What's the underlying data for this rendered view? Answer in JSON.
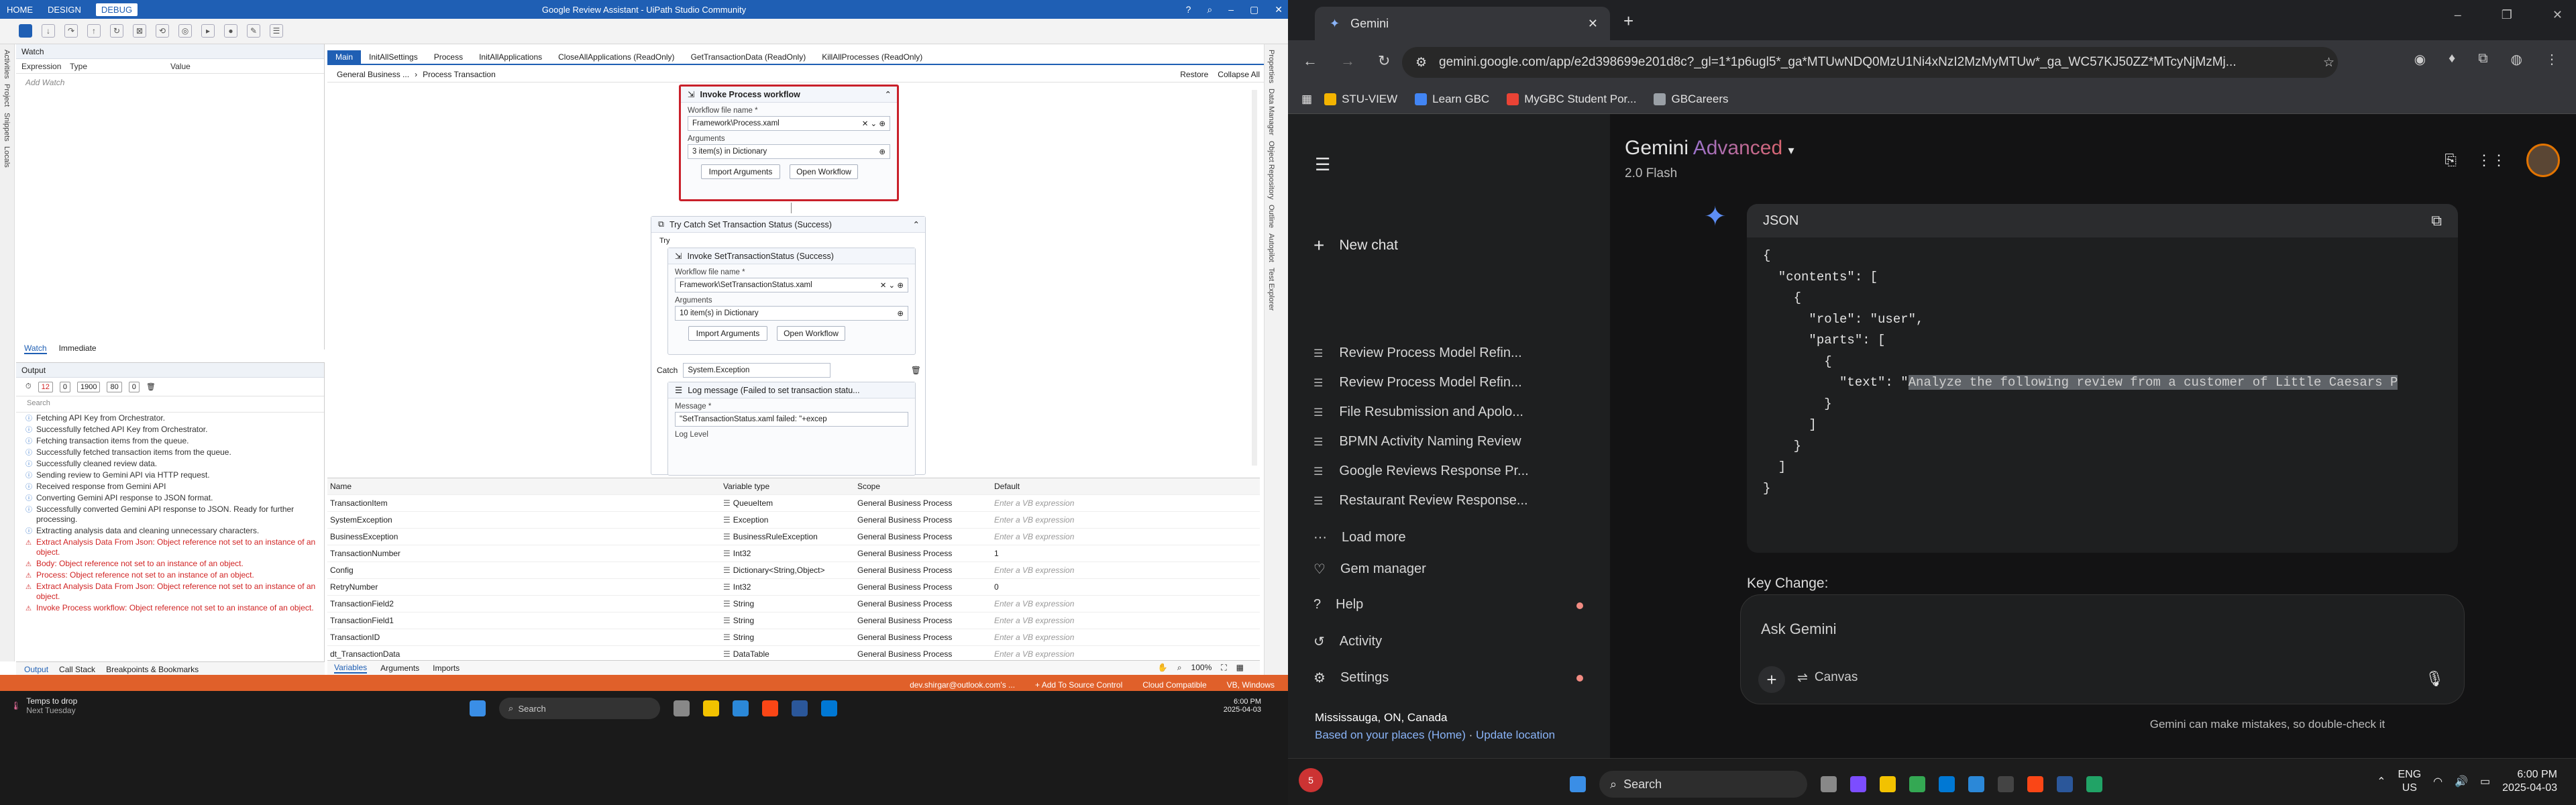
{
  "uipath": {
    "menu": [
      "HOME",
      "DESIGN",
      "DEBUG"
    ],
    "title": "Google Review Assistant - UiPath Studio Community",
    "watch": {
      "title": "Watch",
      "cols": [
        "Expression",
        "Type",
        "Value"
      ],
      "add": "Add Watch"
    },
    "side_left": [
      "Activities",
      "Project",
      "Snippets",
      "Locals"
    ],
    "wi_tabs": [
      "Watch",
      "Immediate"
    ],
    "output": {
      "title": "Output",
      "chips": [
        "12",
        "0",
        "1900",
        "80",
        "0"
      ],
      "search": "Search",
      "lines": [
        {
          "t": "Fetching API Key from Orchestrator.",
          "err": false
        },
        {
          "t": "Successfully fetched API Key from Orchestrator.",
          "err": false
        },
        {
          "t": "Fetching transaction items from the queue.",
          "err": false
        },
        {
          "t": "Successfully fetched transaction items from the queue.",
          "err": false
        },
        {
          "t": "Successfully cleaned review data.",
          "err": false
        },
        {
          "t": "Sending review to Gemini API via HTTP request.",
          "err": false
        },
        {
          "t": "Received response from Gemini API",
          "err": false
        },
        {
          "t": "Converting Gemini API response to JSON format.",
          "err": false
        },
        {
          "t": "Successfully converted Gemini API response to JSON. Ready for further processing.",
          "err": false
        },
        {
          "t": "Extracting analysis data and cleaning unnecessary characters.",
          "err": false
        },
        {
          "t": "Extract Analysis Data From Json: Object reference not set to an instance of an object.",
          "err": true
        },
        {
          "t": "Body: Object reference not set to an instance of an object.",
          "err": true
        },
        {
          "t": "Process: Object reference not set to an instance of an object.",
          "err": true
        },
        {
          "t": "Extract Analysis Data From Json: Object reference not set to an instance of an object.",
          "err": true
        },
        {
          "t": "Invoke Process workflow: Object reference not set to an instance of an object.",
          "err": true
        }
      ]
    },
    "bottom_tabs": [
      "Output",
      "Call Stack",
      "Breakpoints & Bookmarks"
    ],
    "doc_tabs": [
      "Main",
      "InitAllSettings",
      "Process",
      "InitAllApplications",
      "CloseAllApplications (ReadOnly)",
      "GetTransactionData (ReadOnly)",
      "KillAllProcesses (ReadOnly)"
    ],
    "crumbs": [
      "General Business ...",
      "Process Transaction"
    ],
    "crumb_actions": [
      "Restore",
      "Collapse All"
    ],
    "invoke_process": {
      "title": "Invoke Process workflow",
      "file_label": "Workflow file name *",
      "file": "Framework\\Process.xaml",
      "args_label": "Arguments",
      "args": "3 item(s) in Dictionary",
      "import": "Import Arguments",
      "open": "Open Workflow"
    },
    "try_catch": {
      "title": "Try Catch Set Transaction Status (Success)",
      "try": "Try",
      "catch": "Catch",
      "exception": "System.Exception"
    },
    "invoke_status": {
      "title": "Invoke SetTransactionStatus (Success)",
      "file_label": "Workflow file name *",
      "file": "Framework\\SetTransactionStatus.xaml",
      "args_label": "Arguments",
      "args": "10 item(s) in Dictionary",
      "import": "Import Arguments",
      "open": "Open Workflow"
    },
    "log_message": {
      "title": "Log message (Failed to set transaction statu...",
      "msg_label": "Message *",
      "msg": "\"SetTransactionStatus.xaml failed: \"+excep",
      "level_label": "Log Level"
    },
    "vars": {
      "headers": [
        "Name",
        "Variable type",
        "Scope",
        "Default"
      ],
      "rows": [
        {
          "name": "TransactionItem",
          "type": "QueueItem",
          "scope": "General Business Process",
          "def": "Enter a VB expression",
          "ph": true
        },
        {
          "name": "SystemException",
          "type": "Exception",
          "scope": "General Business Process",
          "def": "Enter a VB expression",
          "ph": true
        },
        {
          "name": "BusinessException",
          "type": "BusinessRuleException",
          "scope": "General Business Process",
          "def": "Enter a VB expression",
          "ph": true
        },
        {
          "name": "TransactionNumber",
          "type": "Int32",
          "scope": "General Business Process",
          "def": "1",
          "ph": false
        },
        {
          "name": "Config",
          "type": "Dictionary<String,Object>",
          "scope": "General Business Process",
          "def": "Enter a VB expression",
          "ph": true
        },
        {
          "name": "RetryNumber",
          "type": "Int32",
          "scope": "General Business Process",
          "def": "0",
          "ph": false
        },
        {
          "name": "TransactionField2",
          "type": "String",
          "scope": "General Business Process",
          "def": "Enter a VB expression",
          "ph": true
        },
        {
          "name": "TransactionField1",
          "type": "String",
          "scope": "General Business Process",
          "def": "Enter a VB expression",
          "ph": true
        },
        {
          "name": "TransactionID",
          "type": "String",
          "scope": "General Business Process",
          "def": "Enter a VB expression",
          "ph": true
        },
        {
          "name": "dt_TransactionData",
          "type": "DataTable",
          "scope": "General Business Process",
          "def": "Enter a VB expression",
          "ph": true
        }
      ]
    },
    "vars_tabs": [
      "Variables",
      "Arguments",
      "Imports"
    ],
    "zoom": "100%",
    "side_right": [
      "Properties",
      "Data Manager",
      "Object Repository",
      "Outline",
      "Autopilot",
      "Test Explorer"
    ],
    "status": {
      "account": "dev.shirgar@outlook.com's ...",
      "source": "+ Add To Source Control",
      "compat": "Cloud Compatible",
      "platform": "VB, Windows"
    },
    "taskbar": {
      "weather": "Temps to drop",
      "weather_sub": "Next Tuesday",
      "search": "Search",
      "time": "6:00 PM",
      "date": "2025-04-03"
    }
  },
  "chrome": {
    "tab": "Gemini",
    "url": "gemini.google.com/app/e2d398699e201d8c?_gl=1*1p6ugl5*_ga*MTUwNDQ0MzU1Ni4xNzI2MzMyMTUw*_ga_WC57KJ50ZZ*MTcyNjMzMj...",
    "bookmarks": [
      {
        "label": "STU-VIEW",
        "color": "#f4b400"
      },
      {
        "label": "Learn GBC",
        "color": "#4285f4"
      },
      {
        "label": "MyGBC Student Por...",
        "color": "#ea4335"
      },
      {
        "label": "GBCareers",
        "color": "#9aa0a6"
      }
    ],
    "sidebar": {
      "new_chat": "New chat",
      "recent": [
        "Review Process Model Refin...",
        "Review Process Model Refin...",
        "File Resubmission and Apolo...",
        "BPMN Activity Naming Review",
        "Google Reviews Response Pr...",
        "Restaurant Review Response..."
      ],
      "load_more": "Load more",
      "gem": "Gem manager",
      "help": "Help",
      "activity": "Activity",
      "settings": "Settings",
      "location": "Mississauga, ON, Canada",
      "based": "Based on your places (Home)",
      "update": "Update location"
    },
    "header": {
      "gemini": "Gemini",
      "advanced": "Advanced",
      "model": "2.0 Flash"
    },
    "code": {
      "lang": "JSON",
      "lines": [
        "{",
        "  \"contents\": [",
        "    {",
        "      \"role\": \"user\",",
        "      \"parts\": [",
        "        {",
        "          \"text\": \"Analyze the following review from a customer of Little Caesars P",
        "        }",
        "      ]",
        "    }",
        "  ]",
        "}"
      ]
    },
    "key_change": "Key Change:",
    "ask": "Ask Gemini",
    "canvas": "Canvas",
    "disclaimer": "Gemini can make mistakes, so double-check it",
    "taskbar": {
      "search": "Search",
      "lang": "ENG",
      "region": "US",
      "time": "6:00 PM",
      "date": "2025-04-03",
      "badge": "5"
    }
  }
}
